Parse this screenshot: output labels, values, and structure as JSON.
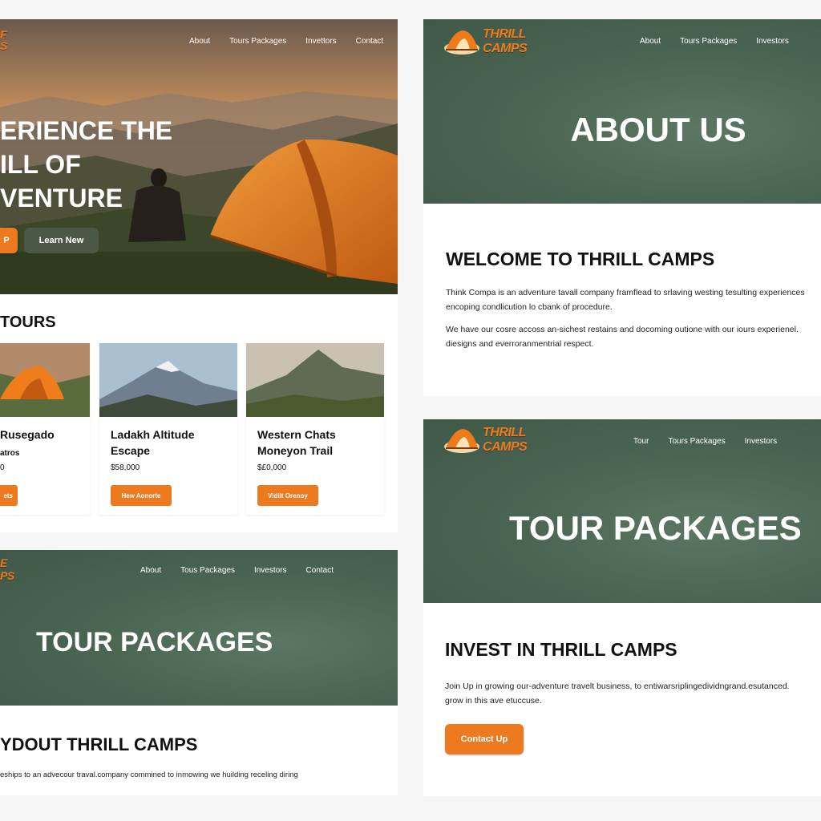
{
  "panel_a": {
    "nav": [
      "About",
      "Tours Packages",
      "Invettors",
      "Contact"
    ],
    "hero_lines": [
      "ERIENCE THE",
      "ILL OF",
      "VENTURE"
    ],
    "btn_primary": "P",
    "btn_secondary": "Learn New",
    "section_title": "TOURS",
    "cards": [
      {
        "name": "Rusegado",
        "sub": "atros",
        "price": "0",
        "cta": "ets"
      },
      {
        "name": "Ladakh Altitude Escape",
        "sub": "",
        "price": "$58,000",
        "cta": "Hew Aonorte"
      },
      {
        "name": "Western Chats Moneyon Trail",
        "sub": "",
        "price": "$£0,000",
        "cta": "Vidilt Orenoy"
      }
    ]
  },
  "panel_b": {
    "logo_line1": "THRILL",
    "logo_line2": "CAMPS",
    "nav": [
      "About",
      "Tours Packages",
      "Investors"
    ],
    "banner_title": "ABOUT US",
    "heading": "WELCOME TO THRILL CAMPS",
    "para1_line1": "Think Compa is an adventure tavall company framflead to srlaving westing tesulting experiences",
    "para1_line2": "encoping condlicution lo cbank of procedure.",
    "para2_line1": "We have our cosre accoss an-sichest restains and docoming outione with our iours experienel.",
    "para2_line2": "diesigns and everroranmentrial respect."
  },
  "panel_c": {
    "logo_line1": "E",
    "logo_line2": "PS",
    "nav": [
      "About",
      "Tous Packages",
      "Investors",
      "Contact"
    ],
    "banner_title": "TOUR PACKAGES",
    "heading": "YDOUT THRILL CAMPS",
    "para": "eships to an advecour traval.company commined to inmowing we huilding receling diring"
  },
  "panel_d": {
    "logo_line1": "THRILL",
    "logo_line2": "CAMPS",
    "nav": [
      "Tour",
      "Tours Packages",
      "Investors"
    ],
    "banner_title": "TOUR PACKAGES",
    "heading": "INVEST IN THRILL CAMPS",
    "para_line1": "Join Up in growing our-adventure travelt business, to entiwarsriplingedividngrand.esutanced.",
    "para_line2": "grow in this ave etuccuse.",
    "cta": "Contact Up"
  },
  "colors": {
    "accent": "#ee7a20",
    "banner_green": "#4b6553",
    "dark_button": "#4a5845"
  },
  "icons": [
    "tent-logo-icon"
  ]
}
